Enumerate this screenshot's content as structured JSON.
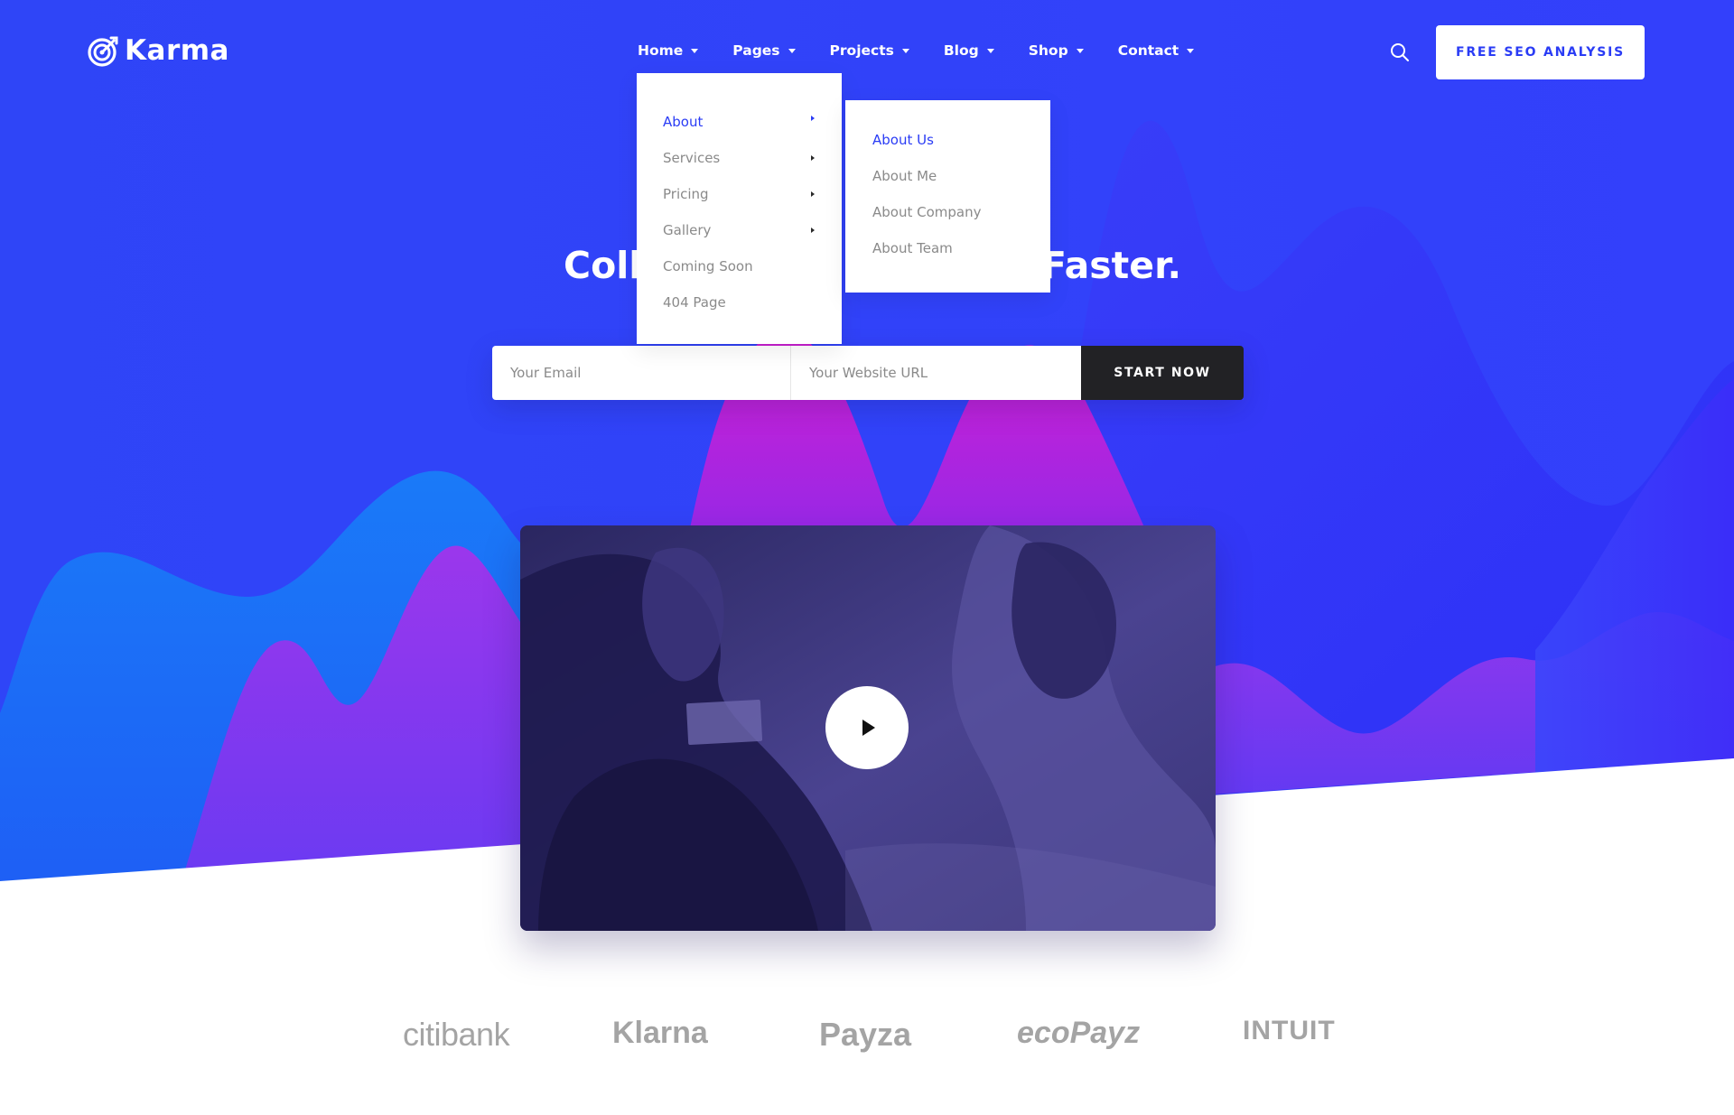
{
  "brand": {
    "name": "Karma",
    "accent_color": "#2a3cf5"
  },
  "nav": {
    "items": [
      {
        "label": "Home"
      },
      {
        "label": "Pages"
      },
      {
        "label": "Projects"
      },
      {
        "label": "Blog"
      },
      {
        "label": "Shop"
      },
      {
        "label": "Contact"
      }
    ],
    "cta_label": "FREE SEO ANALYSIS",
    "search_icon": "search-icon"
  },
  "hero": {
    "headline_left": "Coll",
    "headline_right": "Faster.",
    "email_placeholder": "Your Email",
    "url_placeholder": "Your Website URL",
    "start_label": "START NOW"
  },
  "dropdown": {
    "items": [
      {
        "label": "About",
        "active": true,
        "has_submenu": true
      },
      {
        "label": "Services",
        "has_submenu": true
      },
      {
        "label": "Pricing",
        "has_submenu": true
      },
      {
        "label": "Gallery",
        "has_submenu": true
      },
      {
        "label": "Coming Soon"
      },
      {
        "label": "404 Page"
      }
    ],
    "submenu": [
      {
        "label": "About Us",
        "active": true
      },
      {
        "label": "About Me"
      },
      {
        "label": "About Company"
      },
      {
        "label": "About Team"
      }
    ]
  },
  "video": {
    "play_icon": "play-icon"
  },
  "clients": [
    "citibank",
    "Klarna",
    "Payza",
    "ecoPayz",
    "INTUIT"
  ]
}
